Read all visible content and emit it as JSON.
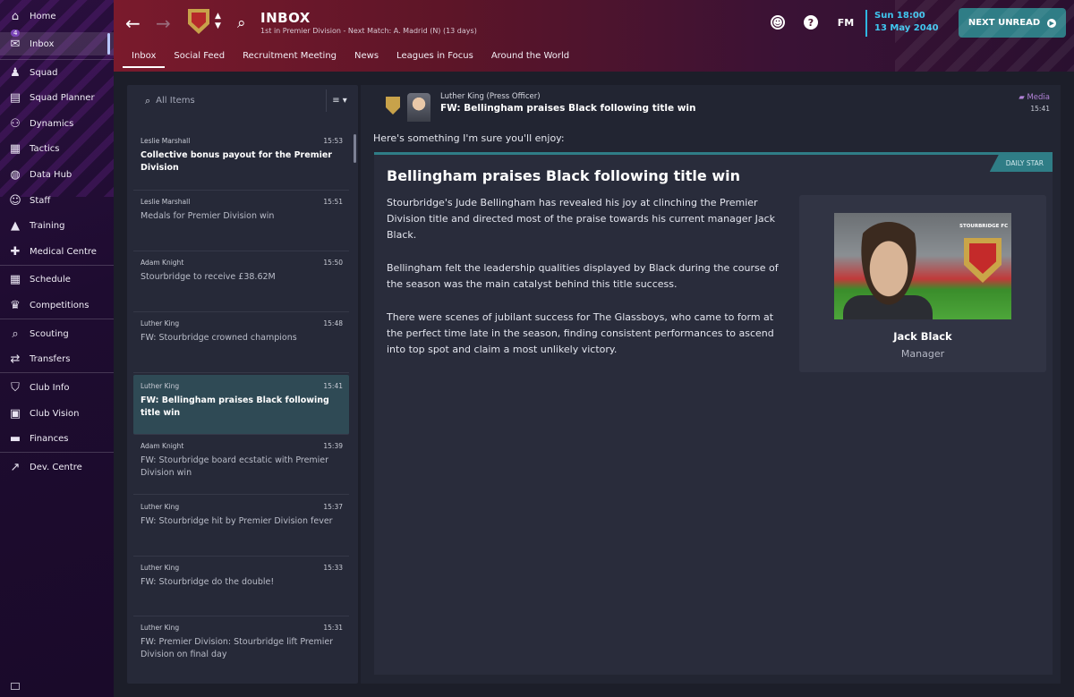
{
  "sidebar": {
    "items": [
      {
        "label": "Home",
        "icon": "home-icon"
      },
      {
        "label": "Inbox",
        "icon": "inbox-icon",
        "badge": "4"
      },
      {
        "label": "Squad",
        "icon": "squad-icon"
      },
      {
        "label": "Squad Planner",
        "icon": "squad-planner-icon"
      },
      {
        "label": "Dynamics",
        "icon": "dynamics-icon"
      },
      {
        "label": "Tactics",
        "icon": "tactics-icon"
      },
      {
        "label": "Data Hub",
        "icon": "data-hub-icon"
      },
      {
        "label": "Staff",
        "icon": "staff-icon"
      },
      {
        "label": "Training",
        "icon": "training-icon"
      },
      {
        "label": "Medical Centre",
        "icon": "medical-icon"
      },
      {
        "label": "Schedule",
        "icon": "schedule-icon"
      },
      {
        "label": "Competitions",
        "icon": "trophy-icon"
      },
      {
        "label": "Scouting",
        "icon": "scouting-icon"
      },
      {
        "label": "Transfers",
        "icon": "transfers-icon"
      },
      {
        "label": "Club Info",
        "icon": "club-info-icon"
      },
      {
        "label": "Club Vision",
        "icon": "club-vision-icon"
      },
      {
        "label": "Finances",
        "icon": "finances-icon"
      },
      {
        "label": "Dev. Centre",
        "icon": "dev-centre-icon"
      }
    ]
  },
  "header": {
    "title": "INBOX",
    "subtitle": "1st in Premier Division - Next Match: A. Madrid (N) (13 days)",
    "tabs": [
      "Inbox",
      "Social Feed",
      "Recruitment Meeting",
      "News",
      "Leagues in Focus",
      "Around the World"
    ],
    "fm_label": "FM",
    "date_line1": "Sun 18:00",
    "date_line2": "13 May 2040",
    "next_unread": "NEXT UNREAD",
    "accent": "#2fb6e2",
    "button_color": "#2f7d86"
  },
  "inbox": {
    "search_placeholder": "All Items",
    "messages": [
      {
        "sender": "Leslie Marshall",
        "time": "15:53",
        "subject": "Collective bonus payout for the Premier Division",
        "unread": true
      },
      {
        "sender": "Leslie Marshall",
        "time": "15:51",
        "subject": "Medals for Premier Division win"
      },
      {
        "sender": "Adam Knight",
        "time": "15:50",
        "subject": "Stourbridge to receive £38.62M"
      },
      {
        "sender": "Luther King",
        "time": "15:48",
        "subject": "FW: Stourbridge crowned champions"
      },
      {
        "sender": "Luther King",
        "time": "15:41",
        "subject": "FW: Bellingham praises Black following title win",
        "selected": true
      },
      {
        "sender": "Adam Knight",
        "time": "15:39",
        "subject": "FW: Stourbridge board ecstatic with Premier Division win"
      },
      {
        "sender": "Luther King",
        "time": "15:37",
        "subject": "FW: Stourbridge hit by Premier Division fever"
      },
      {
        "sender": "Luther King",
        "time": "15:33",
        "subject": "FW: Stourbridge do the double!"
      },
      {
        "sender": "Luther King",
        "time": "15:31",
        "subject": "FW: Premier Division: Stourbridge lift Premier Division on final day"
      }
    ]
  },
  "message": {
    "from": "Luther King  (Press Officer)",
    "title": "FW: Bellingham praises Black following title win",
    "category": "Media",
    "time": "15:41",
    "intro": "Here's something I'm sure you'll enjoy:",
    "article": {
      "headline": "Bellingham praises Black following title win",
      "source": "DAILY STAR",
      "paragraphs": [
        "Stourbridge's Jude Bellingham has revealed his joy at clinching the Premier Division title and directed most of the praise towards his current manager Jack Black.",
        "Bellingham felt the leadership qualities displayed by Black during the course of the season was the main catalyst behind this title success.",
        "There were scenes of jubilant success for The Glassboys, who came to form at the perfect time late in the season, finding consistent performances to ascend into top spot and claim a most unlikely victory."
      ],
      "card": {
        "name": "Jack Black",
        "role": "Manager",
        "club_text": "STOURBRIDGE FC"
      }
    }
  }
}
